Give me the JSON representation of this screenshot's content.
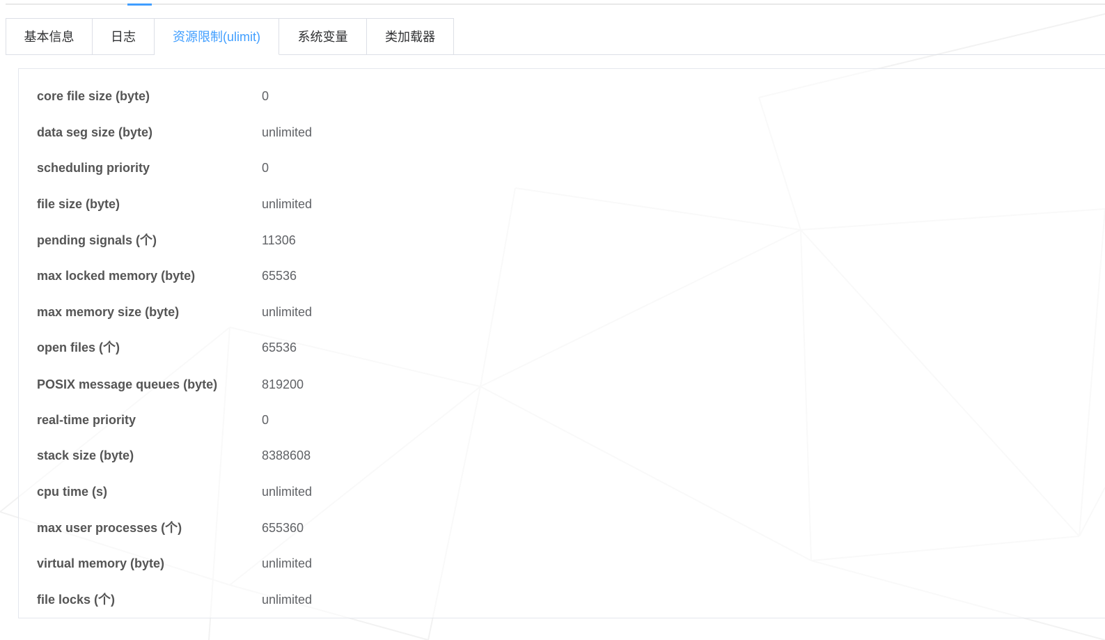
{
  "tabs": [
    {
      "label": "基本信息",
      "active": false
    },
    {
      "label": "日志",
      "active": false
    },
    {
      "label": "资源限制(ulimit)",
      "active": true
    },
    {
      "label": "系统变量",
      "active": false
    },
    {
      "label": "类加载器",
      "active": false
    }
  ],
  "colors": {
    "accent": "#409eff",
    "label_text": "#555555",
    "value_text": "#606266",
    "border": "#dcdfe6"
  },
  "ulimit": {
    "rows": [
      {
        "label": "core file size (byte)",
        "value": "0"
      },
      {
        "label": "data seg size (byte)",
        "value": "unlimited"
      },
      {
        "label": "scheduling priority",
        "value": "0"
      },
      {
        "label": "file size (byte)",
        "value": "unlimited"
      },
      {
        "label": "pending signals (个)",
        "value": "11306"
      },
      {
        "label": "max locked memory (byte)",
        "value": "65536"
      },
      {
        "label": "max memory size (byte)",
        "value": "unlimited"
      },
      {
        "label": "open files (个)",
        "value": "65536"
      },
      {
        "label": "POSIX message queues (byte)",
        "value": "819200"
      },
      {
        "label": "real-time priority",
        "value": "0"
      },
      {
        "label": "stack size (byte)",
        "value": "8388608"
      },
      {
        "label": "cpu time (s)",
        "value": "unlimited"
      },
      {
        "label": "max user processes (个)",
        "value": "655360"
      },
      {
        "label": "virtual memory (byte)",
        "value": "unlimited"
      },
      {
        "label": "file locks (个)",
        "value": "unlimited"
      }
    ]
  }
}
